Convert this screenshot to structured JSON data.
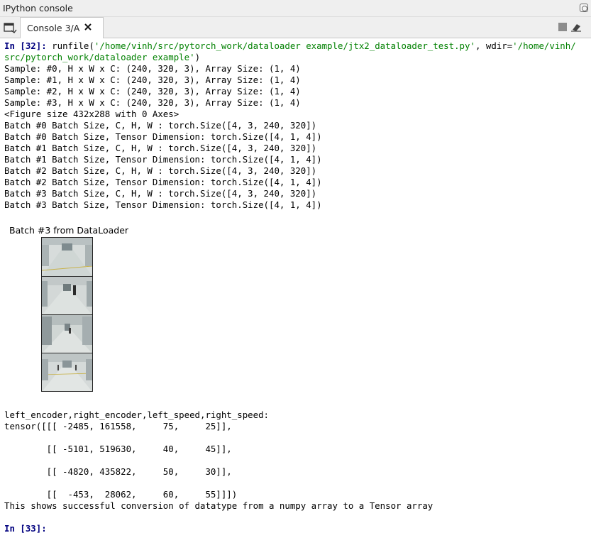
{
  "window": {
    "title": "IPython console"
  },
  "tabs": [
    {
      "label": "Console 3/A"
    }
  ],
  "console": {
    "input_prompt": "In [32]:",
    "command_prefix": " runfile(",
    "command_path": "'/home/vinh/src/pytorch_work/dataloader example/jtx2_dataloader_test.py'",
    "command_mid": ", wdir=",
    "command_wdir_1": "'/home/vinh/",
    "command_wdir_2": "src/pytorch_work/dataloader example'",
    "command_suffix": ")",
    "output_lines": [
      "Sample: #0, H x W x C: (240, 320, 3), Array Size: (1, 4)",
      "Sample: #1, H x W x C: (240, 320, 3), Array Size: (1, 4)",
      "Sample: #2, H x W x C: (240, 320, 3), Array Size: (1, 4)",
      "Sample: #3, H x W x C: (240, 320, 3), Array Size: (1, 4)",
      "<Figure size 432x288 with 0 Axes>",
      "Batch #0 Batch Size, C, H, W : torch.Size([4, 3, 240, 320])",
      "Batch #0 Batch Size, Tensor Dimension: torch.Size([4, 1, 4])",
      "Batch #1 Batch Size, C, H, W : torch.Size([4, 3, 240, 320])",
      "Batch #1 Batch Size, Tensor Dimension: torch.Size([4, 1, 4])",
      "Batch #2 Batch Size, C, H, W : torch.Size([4, 3, 240, 320])",
      "Batch #2 Batch Size, Tensor Dimension: torch.Size([4, 1, 4])",
      "Batch #3 Batch Size, C, H, W : torch.Size([4, 3, 240, 320])",
      "Batch #3 Batch Size, Tensor Dimension: torch.Size([4, 1, 4])"
    ],
    "figure_title": "Batch #3 from DataLoader",
    "tensor_header": "left_encoder,right_encoder,left_speed,right_speed:",
    "tensor_lines": [
      "tensor([[[ -2485, 161558,     75,     25]],",
      "",
      "        [[ -5101, 519630,     40,     45]],",
      "",
      "        [[ -4820, 435822,     50,     30]],",
      "",
      "        [[  -453,  28062,     60,     55]]])"
    ],
    "message": "This shows successful conversion of datatype from a numpy array to a Tensor array",
    "next_prompt": "In [33]:"
  },
  "colors": {
    "prompt": "#00007f",
    "string": "#008000"
  }
}
